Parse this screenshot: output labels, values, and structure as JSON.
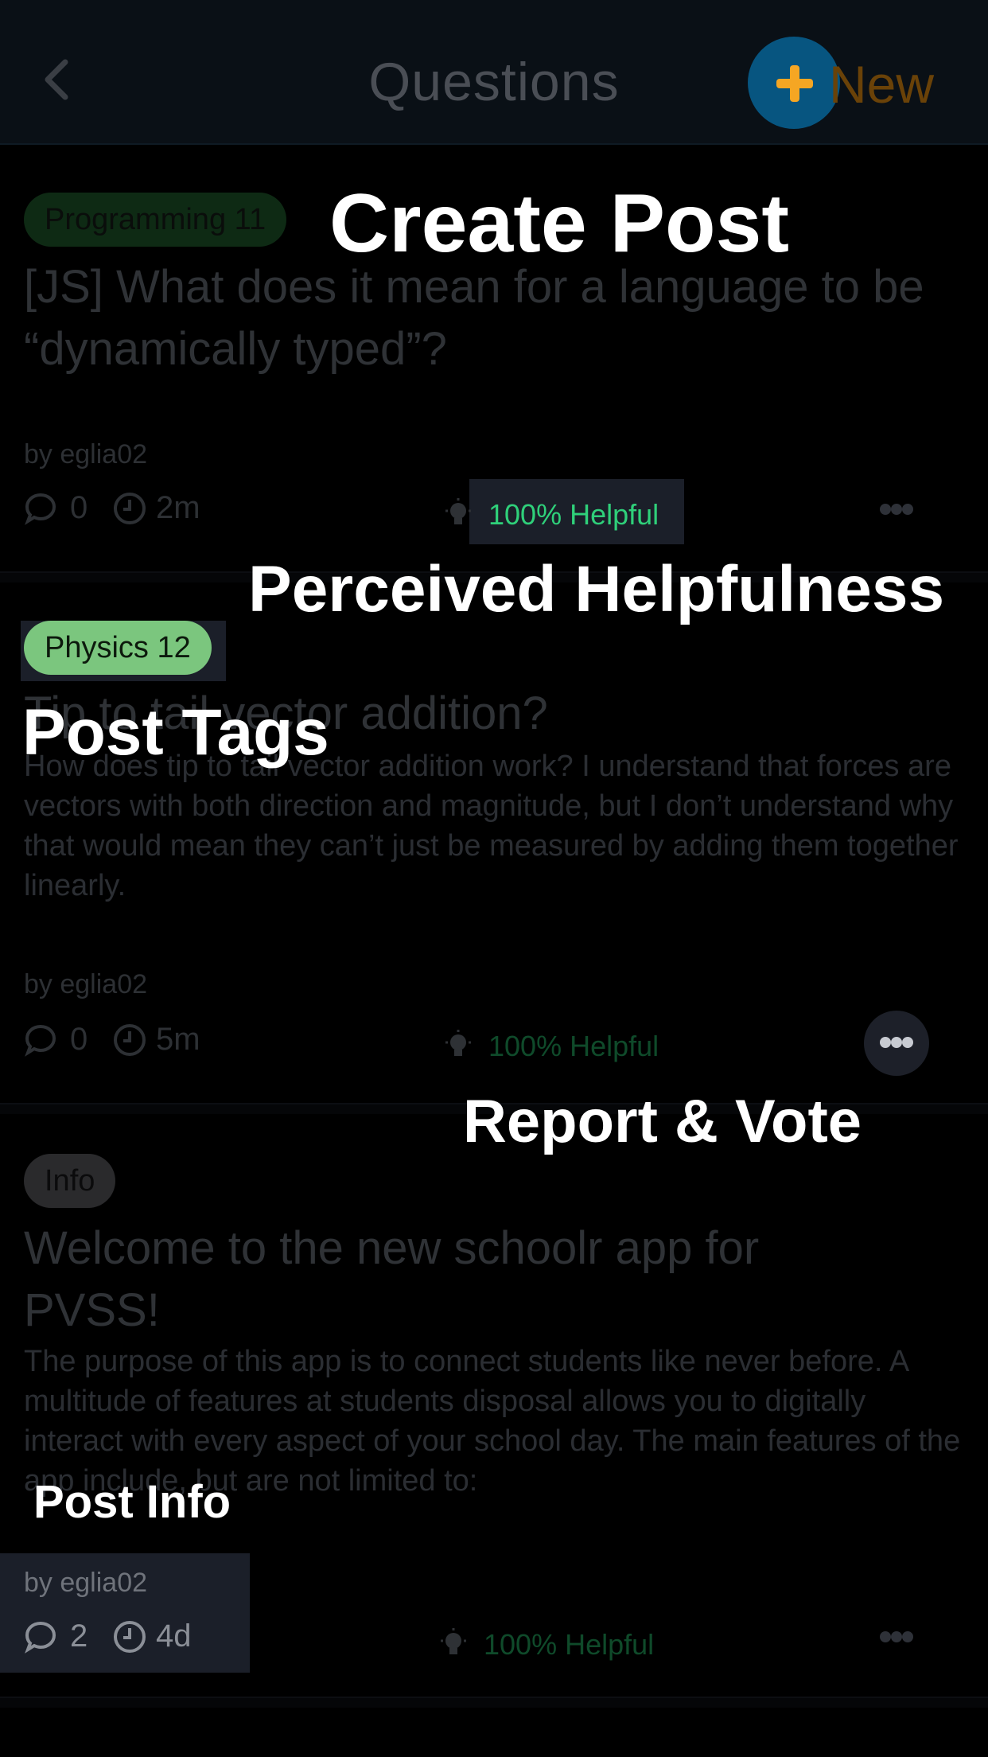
{
  "header": {
    "title": "Questions",
    "new_label": "New"
  },
  "posts": [
    {
      "tag": "Programming 11",
      "title": "[JS] What does it mean for a language to be “dynamically typed”?",
      "body": "",
      "author": "by eglia02",
      "comments": "0",
      "age": "2m",
      "helpful": "100% Helpful"
    },
    {
      "tag": "Physics 12",
      "title": "Tip to tail vector addition?",
      "body": "How does tip to tail vector addition work? I understand that forces are vectors with both direction and magnitude, but I don’t understand why that would mean they can’t just be measured by adding them together linearly.",
      "author": "by eglia02",
      "comments": "0",
      "age": "5m",
      "helpful": "100% Helpful"
    },
    {
      "tag": "Info",
      "title": "Welcome to the new schoolr app for PVSS!",
      "body": "The purpose of this app is to connect students like never before. A multitude of features at students disposal allows you to digitally interact with every aspect of your school day. The main features of the app include, but are not limited to:",
      "author": "by eglia02",
      "comments": "2",
      "age": "4d",
      "helpful": "100% Helpful"
    }
  ],
  "annotations": {
    "create_post": "Create Post",
    "perceived_helpfulness": "Perceived Helpfulness",
    "post_tags": "Post Tags",
    "report_vote": "Report & Vote",
    "post_info": "Post Info"
  },
  "colors": {
    "tag_programming": "#0e2a14",
    "tag_physics": "#7bc67e",
    "tag_info": "#2a2a2c",
    "helpful_bright": "#2fd07a",
    "helpful_dim": "#0f4a2a",
    "new_button": "#075580",
    "new_plus": "#f5a623"
  }
}
